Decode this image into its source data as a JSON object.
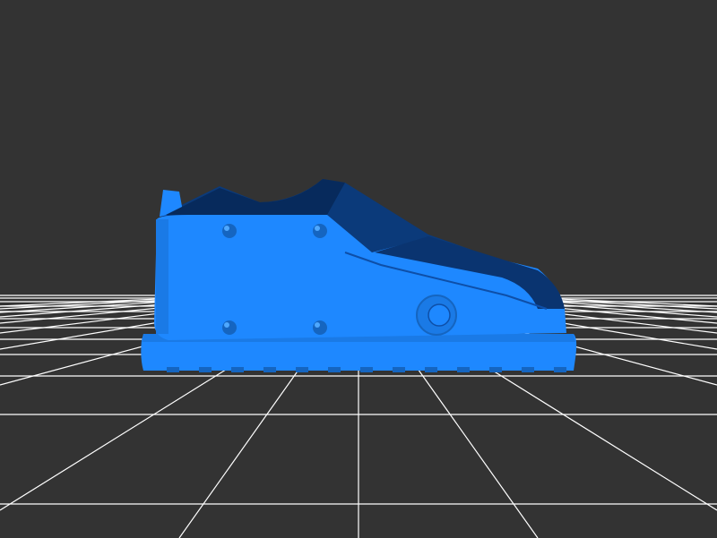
{
  "scene": {
    "background_color": "#333333",
    "grid_color": "#ffffff",
    "model_color": "#1e88ff",
    "model_shadow_color": "#0f4a96",
    "model_dark_color": "#072a5c",
    "model_name": "shoe-model"
  }
}
